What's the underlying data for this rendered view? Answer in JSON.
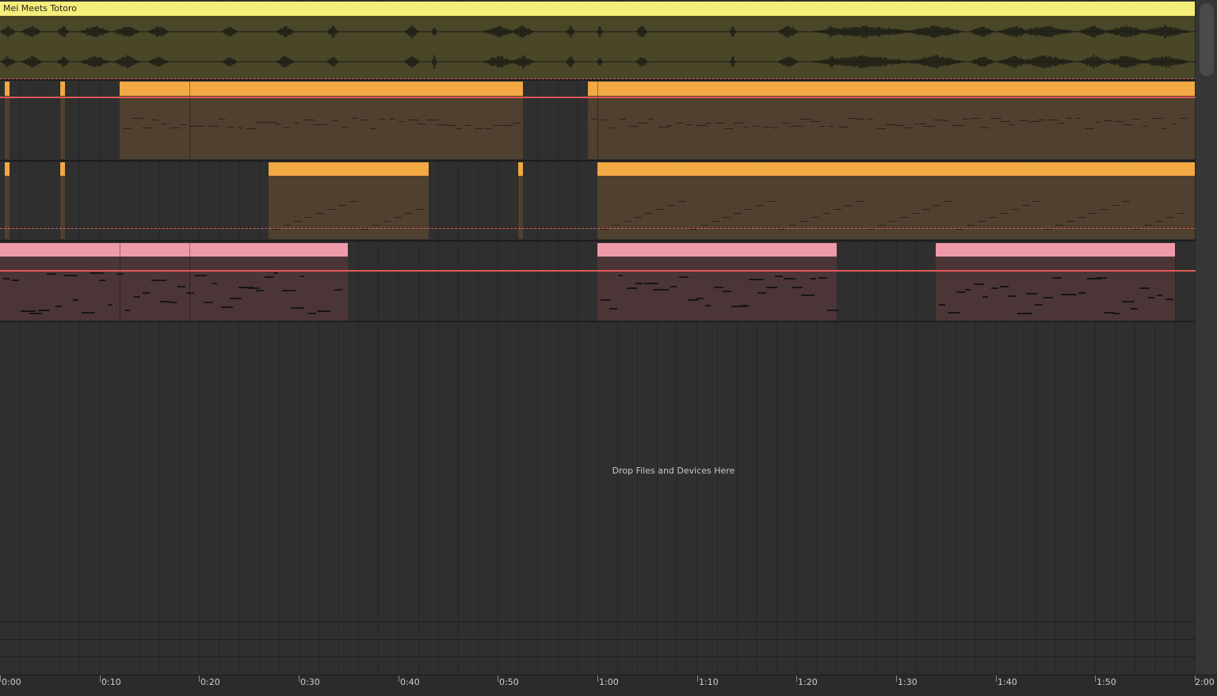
{
  "project": {
    "audio_clip_title": "Mei Meets Totoro",
    "drop_hint": "Drop Files and Devices Here"
  },
  "colors": {
    "audio_clip": "#f4ee7a",
    "midi_orange": "#f2a843",
    "midi_pink": "#ef9aaa",
    "automation": "#e05a55"
  },
  "timeline": {
    "markers": [
      "0:00",
      "0:10",
      "0:20",
      "0:30",
      "0:40",
      "0:50",
      "1:00",
      "1:10",
      "1:20",
      "1:30",
      "1:40",
      "1:50",
      "2:00"
    ]
  },
  "tracks": [
    {
      "name": "audio-track",
      "clip_type": "audio"
    },
    {
      "name": "midi-track-1",
      "clip_type": "midi",
      "color": "orange"
    },
    {
      "name": "midi-track-2",
      "clip_type": "midi",
      "color": "orange"
    },
    {
      "name": "midi-track-3",
      "clip_type": "midi",
      "color": "pink"
    }
  ]
}
